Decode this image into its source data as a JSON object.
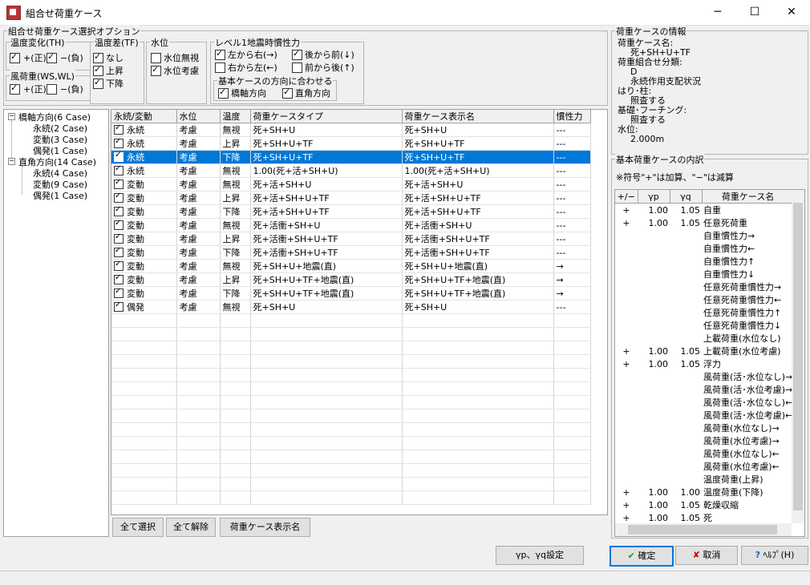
{
  "window": {
    "title": "組合せ荷重ケース",
    "min_glyph": "─",
    "max_glyph": "☐",
    "close_glyph": "✕"
  },
  "options": {
    "title": "組合せ荷重ケース選択オプション",
    "temp_th": {
      "title": "温度変化(TH)",
      "plus": "+(正)",
      "minus": "−(負)"
    },
    "wind": {
      "title": "風荷重(WS,WL)",
      "plus": "+(正)",
      "minus": "−(負)"
    },
    "temp_diff": {
      "title": "温度差(TF)",
      "items": [
        "なし",
        "上昇",
        "下降"
      ]
    },
    "water": {
      "title": "水位",
      "items": [
        "水位無視",
        "水位考慮"
      ]
    },
    "seismic": {
      "title": "レベル1地震時慣性力",
      "items": [
        "左から右(→)",
        "後から前(↓)",
        "右から左(←)",
        "前から後(↑)"
      ]
    },
    "base_dir": {
      "title": "基本ケースの方向に合わせる",
      "items": [
        "橋軸方向",
        "直角方向"
      ]
    }
  },
  "tree": [
    {
      "label": "橋軸方向(6 Case)",
      "children": [
        "永続(2 Case)",
        "変動(3 Case)",
        "偶発(1 Case)"
      ]
    },
    {
      "label": "直角方向(14 Case)",
      "children": [
        "永続(4 Case)",
        "変動(9 Case)",
        "偶発(1 Case)"
      ]
    }
  ],
  "grid": {
    "headers": [
      "永続/変動",
      "水位",
      "温度",
      "荷重ケースタイプ",
      "荷重ケース表示名",
      "慣性力"
    ],
    "rows": [
      [
        "永続",
        "考慮",
        "無視",
        "死+SH+U",
        "死+SH+U",
        "---"
      ],
      [
        "永続",
        "考慮",
        "上昇",
        "死+SH+U+TF",
        "死+SH+U+TF",
        "---"
      ],
      [
        "永続",
        "考慮",
        "下降",
        "死+SH+U+TF",
        "死+SH+U+TF",
        "---"
      ],
      [
        "永続",
        "考慮",
        "無視",
        "1.00(死+活+SH+U)",
        "1.00(死+活+SH+U)",
        "---"
      ],
      [
        "変動",
        "考慮",
        "無視",
        "死+活+SH+U",
        "死+活+SH+U",
        "---"
      ],
      [
        "変動",
        "考慮",
        "上昇",
        "死+活+SH+U+TF",
        "死+活+SH+U+TF",
        "---"
      ],
      [
        "変動",
        "考慮",
        "下降",
        "死+活+SH+U+TF",
        "死+活+SH+U+TF",
        "---"
      ],
      [
        "変動",
        "考慮",
        "無視",
        "死+活衝+SH+U",
        "死+活衝+SH+U",
        "---"
      ],
      [
        "変動",
        "考慮",
        "上昇",
        "死+活衝+SH+U+TF",
        "死+活衝+SH+U+TF",
        "---"
      ],
      [
        "変動",
        "考慮",
        "下降",
        "死+活衝+SH+U+TF",
        "死+活衝+SH+U+TF",
        "---"
      ],
      [
        "変動",
        "考慮",
        "無視",
        "死+SH+U+地震(直)",
        "死+SH+U+地震(直)",
        "→"
      ],
      [
        "変動",
        "考慮",
        "上昇",
        "死+SH+U+TF+地震(直)",
        "死+SH+U+TF+地震(直)",
        "→"
      ],
      [
        "変動",
        "考慮",
        "下降",
        "死+SH+U+TF+地震(直)",
        "死+SH+U+TF+地震(直)",
        "→"
      ],
      [
        "偶発",
        "考慮",
        "無視",
        "死+SH+U",
        "死+SH+U",
        "---"
      ]
    ]
  },
  "buttons": {
    "select_all": "全て選択",
    "deselect_all": "全て解除",
    "display_name": "荷重ケース表示名",
    "gamma": "γp、γq設定",
    "ok": "確定",
    "cancel": "取消",
    "help": "ﾍﾙﾌﾟ(H)"
  },
  "info": {
    "title": "荷重ケースの情報",
    "lines": [
      "荷重ケース名:",
      "死+SH+U+TF",
      "荷重組合せ分類:",
      "D",
      "永続作用支配状況",
      "はり･柱:",
      "照査する",
      "基礎･フーチング:",
      "照査する",
      "水位:",
      "2.000m"
    ]
  },
  "base": {
    "title": "基本荷重ケースの内訳",
    "note": "※符号\"+\"は加算、\"−\"は減算",
    "headers": [
      "+/−",
      "γp",
      "γq",
      "荷重ケース名"
    ],
    "rows": [
      [
        "+",
        "1.00",
        "1.05",
        "自重"
      ],
      [
        "+",
        "1.00",
        "1.05",
        "任意死荷重"
      ],
      [
        "",
        "",
        "",
        "自重慣性力→"
      ],
      [
        "",
        "",
        "",
        "自重慣性力←"
      ],
      [
        "",
        "",
        "",
        "自重慣性力↑"
      ],
      [
        "",
        "",
        "",
        "自重慣性力↓"
      ],
      [
        "",
        "",
        "",
        "任意死荷重慣性力→"
      ],
      [
        "",
        "",
        "",
        "任意死荷重慣性力←"
      ],
      [
        "",
        "",
        "",
        "任意死荷重慣性力↑"
      ],
      [
        "",
        "",
        "",
        "任意死荷重慣性力↓"
      ],
      [
        "",
        "",
        "",
        "上載荷重(水位なし)"
      ],
      [
        "+",
        "1.00",
        "1.05",
        "上載荷重(水位考慮)"
      ],
      [
        "+",
        "1.00",
        "1.05",
        "浮力"
      ],
      [
        "",
        "",
        "",
        "風荷重(活･水位なし)→"
      ],
      [
        "",
        "",
        "",
        "風荷重(活･水位考慮)→"
      ],
      [
        "",
        "",
        "",
        "風荷重(活･水位なし)←"
      ],
      [
        "",
        "",
        "",
        "風荷重(活･水位考慮)←"
      ],
      [
        "",
        "",
        "",
        "風荷重(水位なし)→"
      ],
      [
        "",
        "",
        "",
        "風荷重(水位考慮)→"
      ],
      [
        "",
        "",
        "",
        "風荷重(水位なし)←"
      ],
      [
        "",
        "",
        "",
        "風荷重(水位考慮)←"
      ],
      [
        "",
        "",
        "",
        "温度荷重(上昇)"
      ],
      [
        "+",
        "1.00",
        "1.00",
        "温度荷重(下降)"
      ],
      [
        "+",
        "1.00",
        "1.05",
        "乾燥収縮"
      ],
      [
        "+",
        "1.00",
        "1.05",
        "死"
      ]
    ]
  }
}
